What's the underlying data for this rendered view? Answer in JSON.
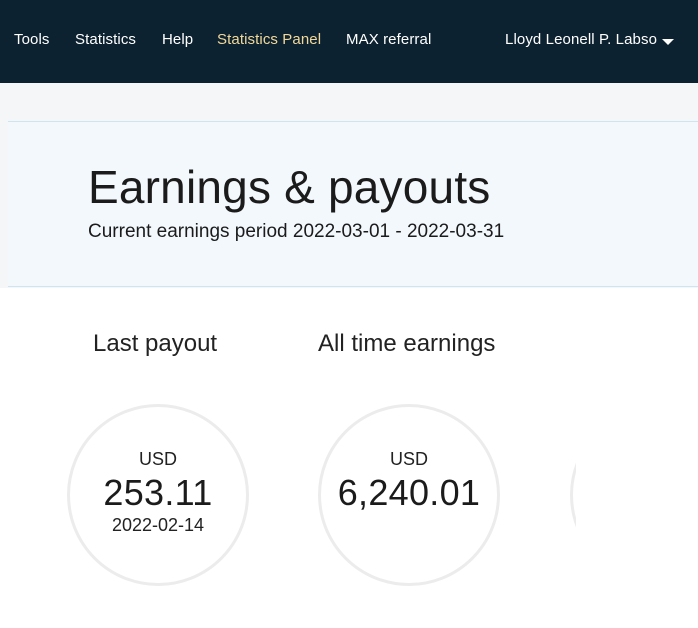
{
  "nav": {
    "items": [
      {
        "label": "Tools"
      },
      {
        "label": "Statistics"
      },
      {
        "label": "Help"
      },
      {
        "label": "Statistics Panel",
        "active": true
      },
      {
        "label": "MAX referral"
      }
    ],
    "user_name": "Lloyd Leonell P. Labso",
    "user_menu_icon": "caret-down-icon",
    "active_color": "#f1d89a",
    "bar_color": "#0d2230"
  },
  "hero": {
    "title": "Earnings & payouts",
    "subtitle": "Current earnings period 2022-03-01 - 2022-03-31"
  },
  "stats": {
    "last_payout": {
      "title": "Last payout",
      "currency": "USD",
      "amount": "253.11",
      "date": "2022-02-14"
    },
    "all_time": {
      "title": "All time earnings",
      "currency": "USD",
      "amount": "6,240.01"
    }
  }
}
